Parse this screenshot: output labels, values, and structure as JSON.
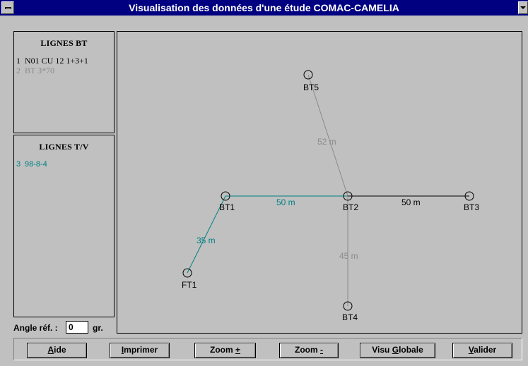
{
  "window": {
    "title": "Visualisation des données d'une étude COMAC-CAMELIA"
  },
  "lignes_bt": {
    "heading": "LIGNES BT",
    "items": [
      {
        "num": "1",
        "label": "N01 CU 12 1+3+1",
        "color": "#000000"
      },
      {
        "num": "2",
        "label": "BT 3*70",
        "color": "#8a8a8a"
      }
    ]
  },
  "lignes_tv": {
    "heading": "LIGNES T/V",
    "items": [
      {
        "num": "3",
        "label": "98-8-4",
        "color": "#008080"
      }
    ]
  },
  "angle": {
    "label": "Angle réf. :",
    "value": "0",
    "unit": "gr."
  },
  "network": {
    "nodes": [
      {
        "id": "BT5",
        "label": "BT5"
      },
      {
        "id": "BT1",
        "label": "BT1"
      },
      {
        "id": "BT2",
        "label": "BT2"
      },
      {
        "id": "BT3",
        "label": "BT3"
      },
      {
        "id": "FT1",
        "label": "FT1"
      },
      {
        "id": "BT4",
        "label": "BT4"
      }
    ],
    "edges": [
      {
        "from": "BT2",
        "to": "BT5",
        "label": "52 m",
        "color": "#8a8a8a"
      },
      {
        "from": "BT1",
        "to": "BT2",
        "label": "50 m",
        "color": "#008080"
      },
      {
        "from": "BT2",
        "to": "BT3",
        "label": "50 m",
        "color": "#000000"
      },
      {
        "from": "BT1",
        "to": "FT1",
        "label": "35 m",
        "color": "#008080"
      },
      {
        "from": "BT2",
        "to": "BT4",
        "label": "45 m",
        "color": "#8a8a8a"
      }
    ]
  },
  "buttons": {
    "aide": {
      "accel": "A",
      "rest": "ide"
    },
    "imprimer": {
      "accel": "I",
      "rest": "mprimer"
    },
    "zoom_plus": {
      "pre": "Zoom ",
      "accel": "+"
    },
    "zoom_minus": {
      "pre": "Zoom ",
      "accel": "-"
    },
    "visu_globale": {
      "pre": "Visu ",
      "accel": "G",
      "rest": "lobale"
    },
    "valider": {
      "accel": "V",
      "rest": "alider"
    }
  }
}
